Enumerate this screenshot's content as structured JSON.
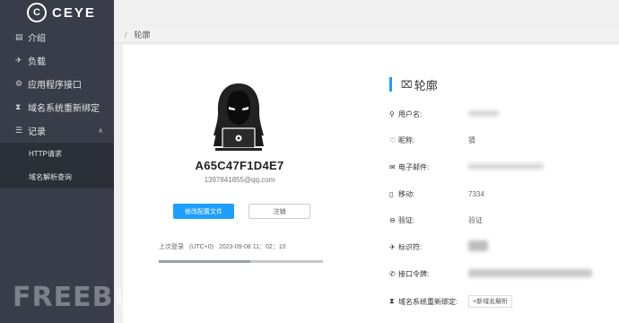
{
  "brand": {
    "logo_mark": "C",
    "name": "CEYE"
  },
  "sidebar": {
    "items": [
      {
        "label": "介绍",
        "icon": "document-icon"
      },
      {
        "label": "负载",
        "icon": "rocket-icon"
      },
      {
        "label": "应用程序接口",
        "icon": "api-icon"
      },
      {
        "label": "域名系统重新绑定",
        "icon": "hourglass-icon"
      },
      {
        "label": "记录",
        "icon": "list-icon"
      }
    ],
    "sub_items": [
      {
        "label": "HTTP请求"
      },
      {
        "label": "域名解析查询"
      }
    ]
  },
  "breadcrumb": {
    "separator": "/",
    "current": "轮廓"
  },
  "profile_card": {
    "name": "A65C47F1D4E7",
    "email": "1397841855@qq.com",
    "edit_button": "修改配置文件",
    "logout_button": "注销",
    "last_login_label": "上次登录",
    "timezone": "(UTC+0)",
    "last_login_time": "2023-09-08 11：02：10",
    "progress": 0.56
  },
  "profile_panel": {
    "title": "轮廓",
    "rows": {
      "username": {
        "label": "用户名:"
      },
      "nickname": {
        "label": "昵称:",
        "value": "猜"
      },
      "email": {
        "label": "电子邮件:"
      },
      "mobile": {
        "label": "移动:",
        "value": "7334"
      },
      "verify": {
        "label": "验证:",
        "value": "验证"
      },
      "identifier": {
        "label": "标识符:"
      },
      "token": {
        "label": "接口令牌:"
      },
      "dns_rebinding": {
        "label": "域名系统重新绑定:",
        "button": "+新域名解析"
      }
    }
  },
  "watermark": "FREEBUF",
  "colors": {
    "sidebar_bg": "#393d49",
    "accent": "#1e9fff"
  }
}
